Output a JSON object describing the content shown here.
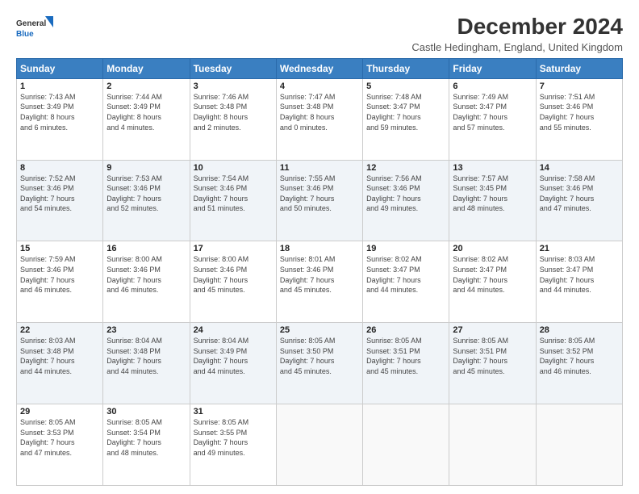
{
  "header": {
    "logo_line1": "General",
    "logo_line2": "Blue",
    "main_title": "December 2024",
    "subtitle": "Castle Hedingham, England, United Kingdom"
  },
  "calendar": {
    "columns": [
      "Sunday",
      "Monday",
      "Tuesday",
      "Wednesday",
      "Thursday",
      "Friday",
      "Saturday"
    ],
    "rows": [
      [
        {
          "day": "1",
          "info": "Sunrise: 7:43 AM\nSunset: 3:49 PM\nDaylight: 8 hours\nand 6 minutes."
        },
        {
          "day": "2",
          "info": "Sunrise: 7:44 AM\nSunset: 3:49 PM\nDaylight: 8 hours\nand 4 minutes."
        },
        {
          "day": "3",
          "info": "Sunrise: 7:46 AM\nSunset: 3:48 PM\nDaylight: 8 hours\nand 2 minutes."
        },
        {
          "day": "4",
          "info": "Sunrise: 7:47 AM\nSunset: 3:48 PM\nDaylight: 8 hours\nand 0 minutes."
        },
        {
          "day": "5",
          "info": "Sunrise: 7:48 AM\nSunset: 3:47 PM\nDaylight: 7 hours\nand 59 minutes."
        },
        {
          "day": "6",
          "info": "Sunrise: 7:49 AM\nSunset: 3:47 PM\nDaylight: 7 hours\nand 57 minutes."
        },
        {
          "day": "7",
          "info": "Sunrise: 7:51 AM\nSunset: 3:46 PM\nDaylight: 7 hours\nand 55 minutes."
        }
      ],
      [
        {
          "day": "8",
          "info": "Sunrise: 7:52 AM\nSunset: 3:46 PM\nDaylight: 7 hours\nand 54 minutes."
        },
        {
          "day": "9",
          "info": "Sunrise: 7:53 AM\nSunset: 3:46 PM\nDaylight: 7 hours\nand 52 minutes."
        },
        {
          "day": "10",
          "info": "Sunrise: 7:54 AM\nSunset: 3:46 PM\nDaylight: 7 hours\nand 51 minutes."
        },
        {
          "day": "11",
          "info": "Sunrise: 7:55 AM\nSunset: 3:46 PM\nDaylight: 7 hours\nand 50 minutes."
        },
        {
          "day": "12",
          "info": "Sunrise: 7:56 AM\nSunset: 3:46 PM\nDaylight: 7 hours\nand 49 minutes."
        },
        {
          "day": "13",
          "info": "Sunrise: 7:57 AM\nSunset: 3:45 PM\nDaylight: 7 hours\nand 48 minutes."
        },
        {
          "day": "14",
          "info": "Sunrise: 7:58 AM\nSunset: 3:46 PM\nDaylight: 7 hours\nand 47 minutes."
        }
      ],
      [
        {
          "day": "15",
          "info": "Sunrise: 7:59 AM\nSunset: 3:46 PM\nDaylight: 7 hours\nand 46 minutes."
        },
        {
          "day": "16",
          "info": "Sunrise: 8:00 AM\nSunset: 3:46 PM\nDaylight: 7 hours\nand 46 minutes."
        },
        {
          "day": "17",
          "info": "Sunrise: 8:00 AM\nSunset: 3:46 PM\nDaylight: 7 hours\nand 45 minutes."
        },
        {
          "day": "18",
          "info": "Sunrise: 8:01 AM\nSunset: 3:46 PM\nDaylight: 7 hours\nand 45 minutes."
        },
        {
          "day": "19",
          "info": "Sunrise: 8:02 AM\nSunset: 3:47 PM\nDaylight: 7 hours\nand 44 minutes."
        },
        {
          "day": "20",
          "info": "Sunrise: 8:02 AM\nSunset: 3:47 PM\nDaylight: 7 hours\nand 44 minutes."
        },
        {
          "day": "21",
          "info": "Sunrise: 8:03 AM\nSunset: 3:47 PM\nDaylight: 7 hours\nand 44 minutes."
        }
      ],
      [
        {
          "day": "22",
          "info": "Sunrise: 8:03 AM\nSunset: 3:48 PM\nDaylight: 7 hours\nand 44 minutes."
        },
        {
          "day": "23",
          "info": "Sunrise: 8:04 AM\nSunset: 3:48 PM\nDaylight: 7 hours\nand 44 minutes."
        },
        {
          "day": "24",
          "info": "Sunrise: 8:04 AM\nSunset: 3:49 PM\nDaylight: 7 hours\nand 44 minutes."
        },
        {
          "day": "25",
          "info": "Sunrise: 8:05 AM\nSunset: 3:50 PM\nDaylight: 7 hours\nand 45 minutes."
        },
        {
          "day": "26",
          "info": "Sunrise: 8:05 AM\nSunset: 3:51 PM\nDaylight: 7 hours\nand 45 minutes."
        },
        {
          "day": "27",
          "info": "Sunrise: 8:05 AM\nSunset: 3:51 PM\nDaylight: 7 hours\nand 45 minutes."
        },
        {
          "day": "28",
          "info": "Sunrise: 8:05 AM\nSunset: 3:52 PM\nDaylight: 7 hours\nand 46 minutes."
        }
      ],
      [
        {
          "day": "29",
          "info": "Sunrise: 8:05 AM\nSunset: 3:53 PM\nDaylight: 7 hours\nand 47 minutes."
        },
        {
          "day": "30",
          "info": "Sunrise: 8:05 AM\nSunset: 3:54 PM\nDaylight: 7 hours\nand 48 minutes."
        },
        {
          "day": "31",
          "info": "Sunrise: 8:05 AM\nSunset: 3:55 PM\nDaylight: 7 hours\nand 49 minutes."
        },
        {
          "day": "",
          "info": ""
        },
        {
          "day": "",
          "info": ""
        },
        {
          "day": "",
          "info": ""
        },
        {
          "day": "",
          "info": ""
        }
      ]
    ]
  }
}
